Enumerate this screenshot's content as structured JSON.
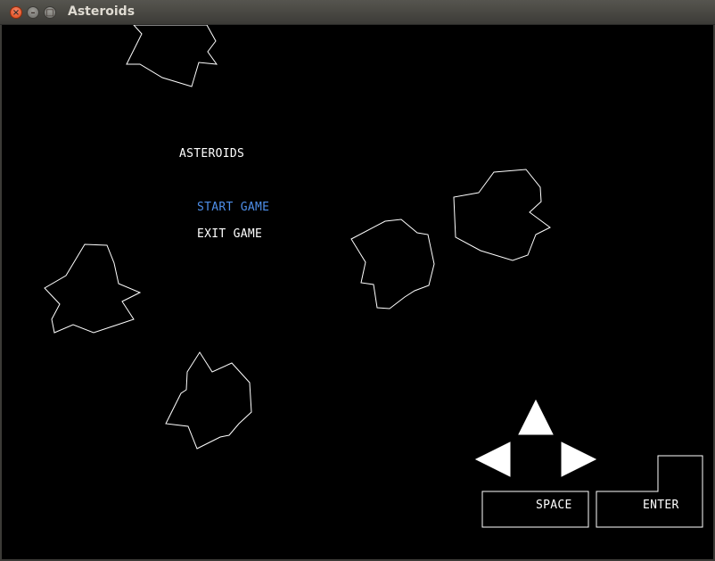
{
  "window": {
    "title": "Asteroids",
    "close_icon": "×",
    "minimize_icon": "–",
    "maximize_icon": "□"
  },
  "menu": {
    "title": "ASTEROIDS",
    "options": [
      {
        "label": "START GAME",
        "selected": true,
        "color": "#4e8ee8"
      },
      {
        "label": "EXIT GAME",
        "selected": false,
        "color": "#ffffff"
      }
    ]
  },
  "controls": {
    "space_label": "SPACE",
    "enter_label": "ENTER",
    "arrow_icons": [
      "arrow-up-icon",
      "arrow-left-icon",
      "arrow-right-icon"
    ]
  },
  "colors": {
    "background": "#000000",
    "outline": "#ffffff",
    "selected": "#4e8ee8"
  }
}
